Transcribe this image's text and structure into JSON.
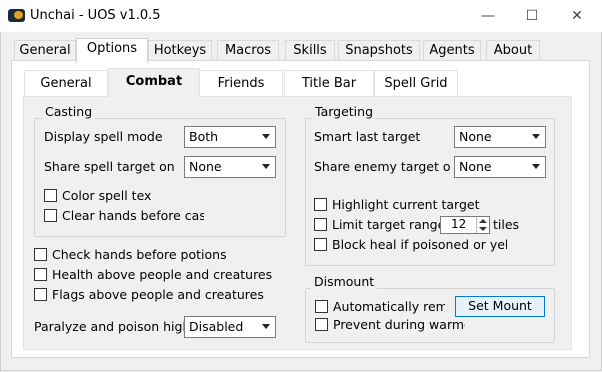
{
  "window": {
    "title": "Unchai - UOS v1.0.5",
    "minimize": "—",
    "maximize": "☐",
    "close": "✕"
  },
  "outer_tabs": [
    "General",
    "Options",
    "Hotkeys",
    "Macros",
    "Skills",
    "Snapshots",
    "Agents",
    "About"
  ],
  "outer_active": "Options",
  "inner_tabs": [
    "General",
    "Combat",
    "Friends",
    "Title Bar",
    "Spell Grid"
  ],
  "inner_active": "Combat",
  "casting": {
    "title": "Casting",
    "display_spell_mode_label": "Display spell mode",
    "display_spell_mode_value": "Both",
    "share_spell_target_label": "Share spell target on",
    "share_spell_target_value": "None",
    "color_spell_text": "Color spell tex",
    "clear_hands": "Clear hands before castir"
  },
  "misc": {
    "check_hands": "Check hands before potions",
    "health_above": "Health above people and creatures",
    "flags_above": "Flags above people and creatures",
    "paralyze_label": "Paralyze and poison highli",
    "paralyze_value": "Disabled"
  },
  "targeting": {
    "title": "Targeting",
    "smart_last_label": "Smart last target",
    "smart_last_value": "None",
    "share_enemy_label": "Share enemy target o",
    "share_enemy_value": "None",
    "highlight_current": "Highlight current target",
    "limit_range": "Limit target range t",
    "limit_range_value": "12",
    "tiles": "tiles",
    "block_heal": "Block heal if poisoned or yello"
  },
  "dismount": {
    "title": "Dismount",
    "auto_remount": "Automatically remou",
    "set_mount": "Set Mount",
    "prevent_warmode": "Prevent during warmod"
  }
}
